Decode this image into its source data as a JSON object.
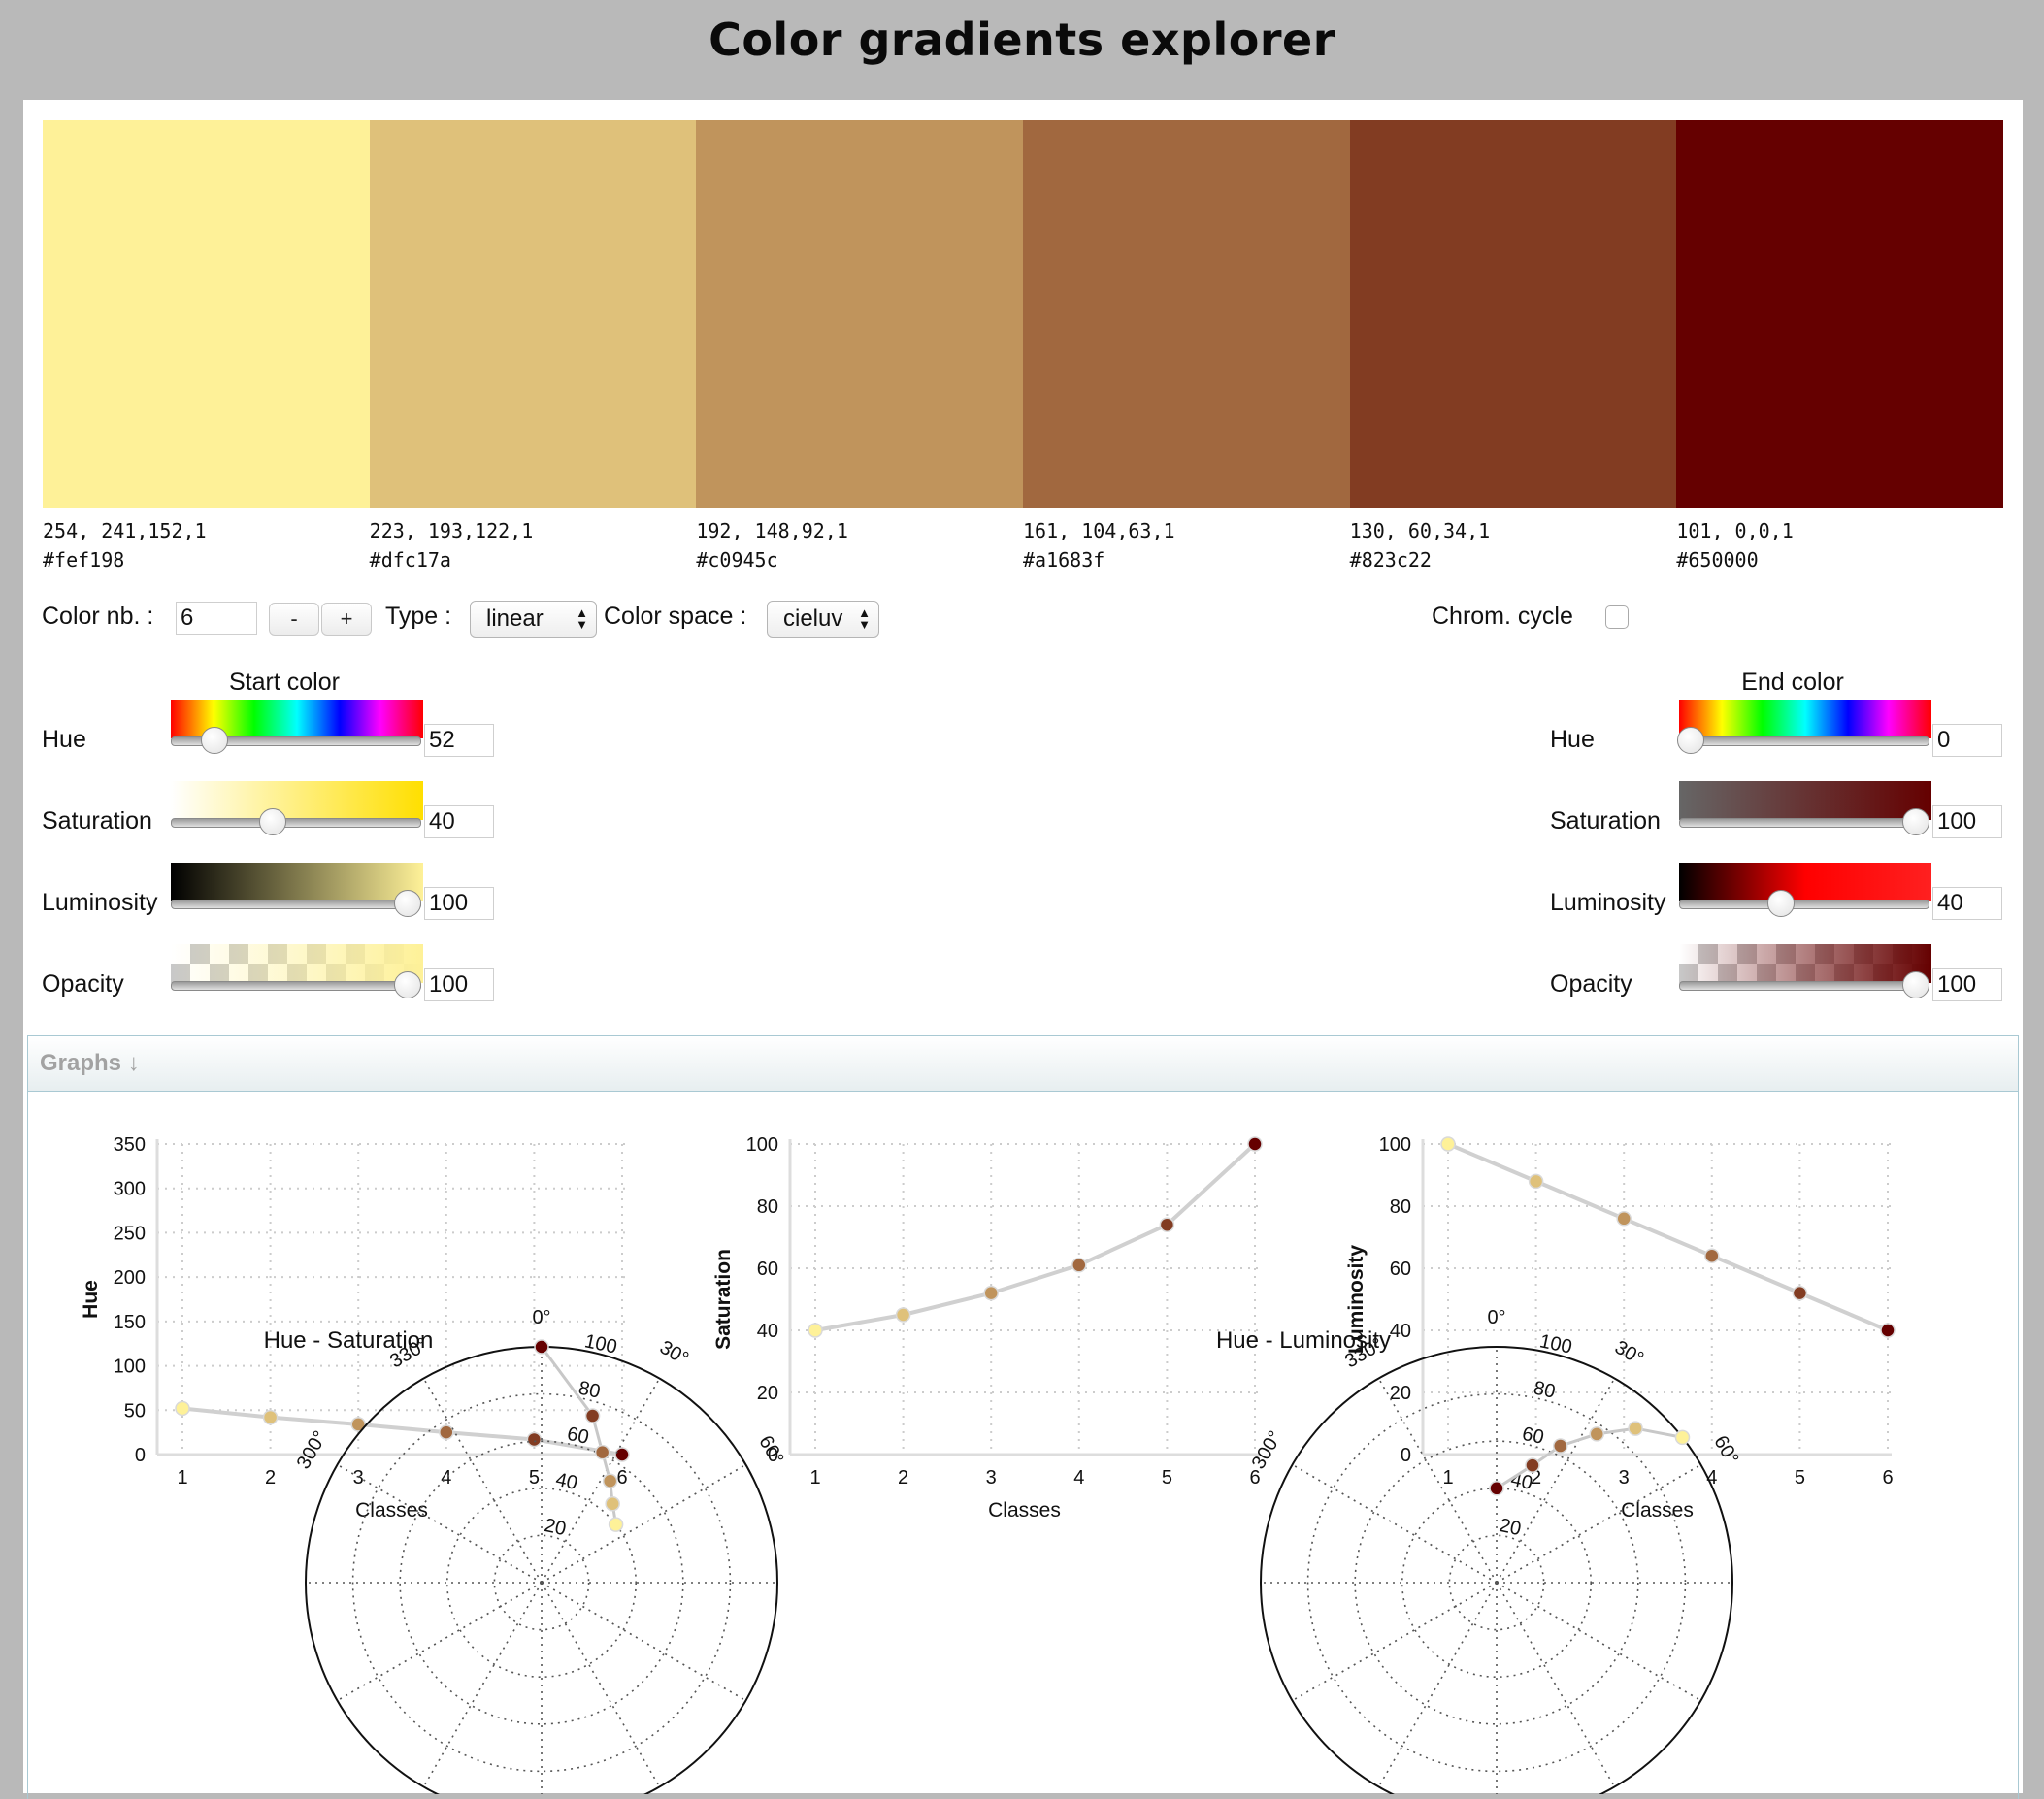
{
  "app": {
    "title": "Color gradients explorer"
  },
  "swatches": [
    {
      "color": "#fef198",
      "rgb": "254, 241,152,1",
      "hex": "#fef198"
    },
    {
      "color": "#dfc17a",
      "rgb": "223, 193,122,1",
      "hex": "#dfc17a"
    },
    {
      "color": "#c0945c",
      "rgb": "192, 148,92,1",
      "hex": "#c0945c"
    },
    {
      "color": "#a1683f",
      "rgb": "161, 104,63,1",
      "hex": "#a1683f"
    },
    {
      "color": "#823c22",
      "rgb": "130, 60,34,1",
      "hex": "#823c22"
    },
    {
      "color": "#650000",
      "rgb": "101, 0,0,1",
      "hex": "#650000"
    }
  ],
  "controls": {
    "color_nb_label": "Color nb. :",
    "color_nb_value": "6",
    "minus_label": "-",
    "plus_label": "+",
    "type_label": "Type :",
    "type_value": "linear",
    "space_label": "Color space :",
    "space_value": "cieluv",
    "chrom_cycle_label": "Chrom. cycle",
    "chrom_cycle_checked": false
  },
  "start_color": {
    "title": "Start color",
    "hue_label": "Hue",
    "hue_value": "52",
    "hue_level": 0.144,
    "saturation_label": "Saturation",
    "saturation_value": "40",
    "saturation_level": 0.4,
    "luminosity_label": "Luminosity",
    "luminosity_value": "100",
    "luminosity_level": 1.0,
    "opacity_label": "Opacity",
    "opacity_value": "100",
    "opacity_level": 1.0,
    "sat_strip_end": "#ffdf00",
    "lum_strip_end": "#fef198"
  },
  "end_color": {
    "title": "End color",
    "hue_label": "Hue",
    "hue_value": "0",
    "hue_level": 0.0,
    "saturation_label": "Saturation",
    "saturation_value": "100",
    "saturation_level": 1.0,
    "luminosity_label": "Luminosity",
    "luminosity_value": "40",
    "luminosity_level": 0.4,
    "opacity_label": "Opacity",
    "opacity_value": "100",
    "opacity_level": 1.0,
    "sat_strip_end": "#650000",
    "lum_strip_end": "#ff0000"
  },
  "graphs": {
    "header": "Graphs ↓"
  },
  "chart_data": [
    {
      "type": "line",
      "xlabel": "Classes",
      "ylabel": "Hue",
      "x": [
        1,
        2,
        3,
        4,
        5,
        6
      ],
      "y": [
        52,
        42,
        34,
        25,
        17,
        0
      ],
      "xticks": [
        "1",
        "2",
        "3",
        "4",
        "5",
        "6"
      ],
      "yticks": [
        "0",
        "50",
        "100",
        "150",
        "200",
        "250",
        "300",
        "350"
      ],
      "ylim": [
        0,
        350
      ]
    },
    {
      "type": "line",
      "xlabel": "",
      "ylabel": "Saturation",
      "x": [
        1,
        2,
        3,
        4,
        5,
        6
      ],
      "y": [
        40,
        45,
        52,
        61,
        74,
        100
      ],
      "xticks": [
        "1",
        "2",
        "3",
        "4",
        "5",
        "6"
      ],
      "yticks": [
        "0",
        "20",
        "40",
        "60",
        "80",
        "100"
      ],
      "ylim": [
        0,
        100
      ]
    },
    {
      "type": "line",
      "xlabel": "",
      "ylabel": "Luminosity",
      "x": [
        1,
        2,
        3,
        4,
        5,
        6
      ],
      "y": [
        100,
        88,
        76,
        64,
        52,
        40
      ],
      "xticks": [
        "1",
        "2",
        "3",
        "4",
        "5",
        "6"
      ],
      "yticks": [
        "0",
        "20",
        "40",
        "60",
        "80",
        "100"
      ],
      "ylim": [
        0,
        100
      ]
    },
    {
      "type": "scatter",
      "title": "Hue - Saturation",
      "angle_ticks": [
        "0°",
        "30°",
        "60°",
        "300°",
        "330°"
      ],
      "radial_ticks": [
        "20",
        "40",
        "60",
        "80",
        "100"
      ],
      "theta": [
        52,
        42,
        34,
        25,
        17,
        0
      ],
      "r": [
        40,
        45,
        52,
        61,
        74,
        100
      ]
    },
    {
      "type": "scatter",
      "title": "Hue - Luminosity",
      "angle_ticks": [
        "0°",
        "30°",
        "60°",
        "300°",
        "330°"
      ],
      "radial_ticks": [
        "20",
        "40",
        "60",
        "80",
        "100"
      ],
      "theta": [
        52,
        42,
        34,
        25,
        17,
        0
      ],
      "r": [
        100,
        88,
        76,
        64,
        52,
        40
      ]
    }
  ],
  "x_axis_label": "Classes"
}
